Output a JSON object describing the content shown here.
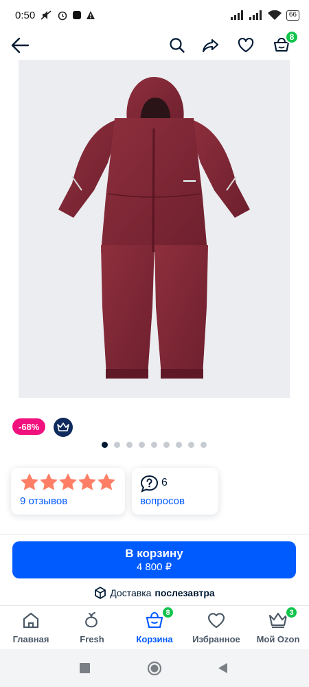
{
  "status_bar": {
    "time": "0:50",
    "battery": "66"
  },
  "header": {
    "cart_count": "8"
  },
  "product": {
    "discount_badge": "-68%",
    "image_count": 9,
    "active_image": 1,
    "rating_stars": 5,
    "reviews_link": "9 отзывов",
    "questions_count": "6",
    "questions_link": "вопросов"
  },
  "buy": {
    "label": "В корзину",
    "price": "4 800 ₽"
  },
  "delivery": {
    "label": "Доставка",
    "when": "послезавтра"
  },
  "nav": {
    "items": [
      {
        "label": "Главная",
        "icon": "home-icon"
      },
      {
        "label": "Fresh",
        "icon": "fresh-icon"
      },
      {
        "label": "Корзина",
        "icon": "cart-icon",
        "badge": "8",
        "active": true
      },
      {
        "label": "Избранное",
        "icon": "heart-icon"
      },
      {
        "label": "Мой Ozon",
        "icon": "crown-icon",
        "badge": "3"
      }
    ]
  },
  "colors": {
    "accent": "#005bff",
    "badge_green": "#10c44c",
    "discount_pink": "#f1117e",
    "star": "#ff7e66"
  }
}
